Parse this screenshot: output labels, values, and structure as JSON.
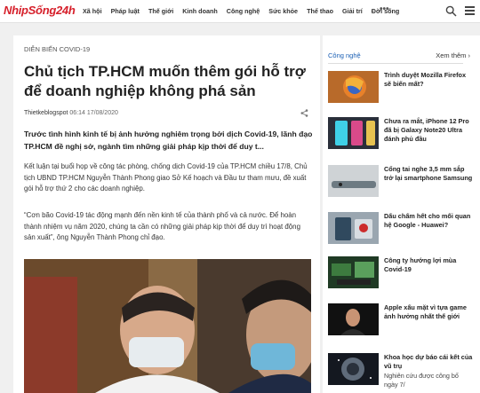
{
  "header": {
    "logo": "NhipSống24h",
    "nav": [
      "Xã hội",
      "Pháp luật",
      "Thế giới",
      "Kinh doanh",
      "Công nghệ",
      "Sức khỏe",
      "Thể thao",
      "Giải trí",
      "Đời sống"
    ],
    "more": "•••",
    "search_icon": "search-icon",
    "menu_icon": "hamburger-menu-icon"
  },
  "article": {
    "category": "DIỄN BIẾN COVID-19",
    "title": "Chủ tịch TP.HCM muốn thêm gói hỗ trợ để doanh nghiệp không phá sản",
    "author": "Thietkeblogspot",
    "date": "06:14 17/08/2020",
    "lead": "Trước tình hình kinh tế bị ảnh hưởng nghiêm trọng bởi dịch Covid-19, lãnh đạo TP.HCM đề nghị sở, ngành tìm những giải pháp kịp thời để duy t...",
    "paragraph1": "Kết luận tại buổi họp về công tác phòng, chống dịch Covid-19 của TP.HCM chiều 17/8, Chủ tịch UBND TP.HCM Nguyễn Thành Phong giao Sở Kế hoạch và Đầu tư tham mưu, đề xuất gói hỗ trợ thứ 2 cho các doanh nghiệp.",
    "paragraph2": "“Cơn bão Covid-19 tác động mạnh đến nền kinh tế của thành phố và cả nước. Để hoàn thành nhiệm vụ năm 2020, chúng ta cần có những giải pháp kịp thời để duy trì hoạt động sản xuất”, ông Nguyễn Thành Phong chỉ đạo."
  },
  "sidebar": {
    "category": "Công nghệ",
    "more_label": "Xem thêm ›",
    "items": [
      {
        "title": "Trình duyệt Mozilla Firefox sẽ biến mất?",
        "sub": ""
      },
      {
        "title": "Chưa ra mắt, iPhone 12 Pro đã bị Galaxy Note20 Ultra đánh phủ đầu",
        "sub": ""
      },
      {
        "title": "Cổng tai nghe 3,5 mm sắp trở lại smartphone Samsung",
        "sub": ""
      },
      {
        "title": "Dấu chấm hết cho mối quan hệ Google - Huawei?",
        "sub": ""
      },
      {
        "title": "Công ty hướng lợi mùa Covid-19",
        "sub": ""
      },
      {
        "title": "Apple xấu mặt vì tựa game ảnh hưởng nhất thế giới",
        "sub": ""
      },
      {
        "title": "Khoa học dự báo cái kết của vũ trụ",
        "sub": "Nghiên cứu được công bố ngày 7/"
      }
    ]
  },
  "colors": {
    "brand": "#d6202b",
    "link": "#1a5fb4"
  }
}
